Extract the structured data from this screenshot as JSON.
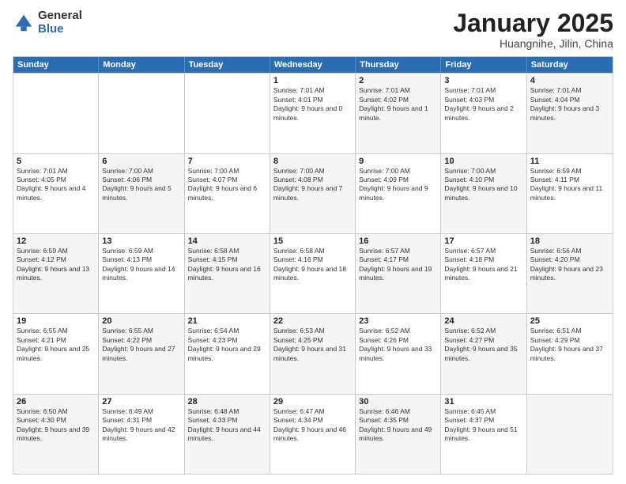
{
  "header": {
    "logo_general": "General",
    "logo_blue": "Blue",
    "title": "January 2025",
    "subtitle": "Huangnihe, Jilin, China"
  },
  "days_of_week": [
    "Sunday",
    "Monday",
    "Tuesday",
    "Wednesday",
    "Thursday",
    "Friday",
    "Saturday"
  ],
  "weeks": [
    [
      {
        "day": "",
        "sunrise": "",
        "sunset": "",
        "daylight": "",
        "shaded": false
      },
      {
        "day": "",
        "sunrise": "",
        "sunset": "",
        "daylight": "",
        "shaded": false
      },
      {
        "day": "",
        "sunrise": "",
        "sunset": "",
        "daylight": "",
        "shaded": false
      },
      {
        "day": "1",
        "sunrise": "Sunrise: 7:01 AM",
        "sunset": "Sunset: 4:01 PM",
        "daylight": "Daylight: 9 hours and 0 minutes.",
        "shaded": false
      },
      {
        "day": "2",
        "sunrise": "Sunrise: 7:01 AM",
        "sunset": "Sunset: 4:02 PM",
        "daylight": "Daylight: 9 hours and 1 minute.",
        "shaded": true
      },
      {
        "day": "3",
        "sunrise": "Sunrise: 7:01 AM",
        "sunset": "Sunset: 4:03 PM",
        "daylight": "Daylight: 9 hours and 2 minutes.",
        "shaded": false
      },
      {
        "day": "4",
        "sunrise": "Sunrise: 7:01 AM",
        "sunset": "Sunset: 4:04 PM",
        "daylight": "Daylight: 9 hours and 3 minutes.",
        "shaded": true
      }
    ],
    [
      {
        "day": "5",
        "sunrise": "Sunrise: 7:01 AM",
        "sunset": "Sunset: 4:05 PM",
        "daylight": "Daylight: 9 hours and 4 minutes.",
        "shaded": false
      },
      {
        "day": "6",
        "sunrise": "Sunrise: 7:00 AM",
        "sunset": "Sunset: 4:06 PM",
        "daylight": "Daylight: 9 hours and 5 minutes.",
        "shaded": true
      },
      {
        "day": "7",
        "sunrise": "Sunrise: 7:00 AM",
        "sunset": "Sunset: 4:07 PM",
        "daylight": "Daylight: 9 hours and 6 minutes.",
        "shaded": false
      },
      {
        "day": "8",
        "sunrise": "Sunrise: 7:00 AM",
        "sunset": "Sunset: 4:08 PM",
        "daylight": "Daylight: 9 hours and 7 minutes.",
        "shaded": true
      },
      {
        "day": "9",
        "sunrise": "Sunrise: 7:00 AM",
        "sunset": "Sunset: 4:09 PM",
        "daylight": "Daylight: 9 hours and 9 minutes.",
        "shaded": false
      },
      {
        "day": "10",
        "sunrise": "Sunrise: 7:00 AM",
        "sunset": "Sunset: 4:10 PM",
        "daylight": "Daylight: 9 hours and 10 minutes.",
        "shaded": true
      },
      {
        "day": "11",
        "sunrise": "Sunrise: 6:59 AM",
        "sunset": "Sunset: 4:11 PM",
        "daylight": "Daylight: 9 hours and 11 minutes.",
        "shaded": false
      }
    ],
    [
      {
        "day": "12",
        "sunrise": "Sunrise: 6:59 AM",
        "sunset": "Sunset: 4:12 PM",
        "daylight": "Daylight: 9 hours and 13 minutes.",
        "shaded": true
      },
      {
        "day": "13",
        "sunrise": "Sunrise: 6:59 AM",
        "sunset": "Sunset: 4:13 PM",
        "daylight": "Daylight: 9 hours and 14 minutes.",
        "shaded": false
      },
      {
        "day": "14",
        "sunrise": "Sunrise: 6:58 AM",
        "sunset": "Sunset: 4:15 PM",
        "daylight": "Daylight: 9 hours and 16 minutes.",
        "shaded": true
      },
      {
        "day": "15",
        "sunrise": "Sunrise: 6:58 AM",
        "sunset": "Sunset: 4:16 PM",
        "daylight": "Daylight: 9 hours and 18 minutes.",
        "shaded": false
      },
      {
        "day": "16",
        "sunrise": "Sunrise: 6:57 AM",
        "sunset": "Sunset: 4:17 PM",
        "daylight": "Daylight: 9 hours and 19 minutes.",
        "shaded": true
      },
      {
        "day": "17",
        "sunrise": "Sunrise: 6:57 AM",
        "sunset": "Sunset: 4:18 PM",
        "daylight": "Daylight: 9 hours and 21 minutes.",
        "shaded": false
      },
      {
        "day": "18",
        "sunrise": "Sunrise: 6:56 AM",
        "sunset": "Sunset: 4:20 PM",
        "daylight": "Daylight: 9 hours and 23 minutes.",
        "shaded": true
      }
    ],
    [
      {
        "day": "19",
        "sunrise": "Sunrise: 6:55 AM",
        "sunset": "Sunset: 4:21 PM",
        "daylight": "Daylight: 9 hours and 25 minutes.",
        "shaded": false
      },
      {
        "day": "20",
        "sunrise": "Sunrise: 6:55 AM",
        "sunset": "Sunset: 4:22 PM",
        "daylight": "Daylight: 9 hours and 27 minutes.",
        "shaded": true
      },
      {
        "day": "21",
        "sunrise": "Sunrise: 6:54 AM",
        "sunset": "Sunset: 4:23 PM",
        "daylight": "Daylight: 9 hours and 29 minutes.",
        "shaded": false
      },
      {
        "day": "22",
        "sunrise": "Sunrise: 6:53 AM",
        "sunset": "Sunset: 4:25 PM",
        "daylight": "Daylight: 9 hours and 31 minutes.",
        "shaded": true
      },
      {
        "day": "23",
        "sunrise": "Sunrise: 6:52 AM",
        "sunset": "Sunset: 4:26 PM",
        "daylight": "Daylight: 9 hours and 33 minutes.",
        "shaded": false
      },
      {
        "day": "24",
        "sunrise": "Sunrise: 6:52 AM",
        "sunset": "Sunset: 4:27 PM",
        "daylight": "Daylight: 9 hours and 35 minutes.",
        "shaded": true
      },
      {
        "day": "25",
        "sunrise": "Sunrise: 6:51 AM",
        "sunset": "Sunset: 4:29 PM",
        "daylight": "Daylight: 9 hours and 37 minutes.",
        "shaded": false
      }
    ],
    [
      {
        "day": "26",
        "sunrise": "Sunrise: 6:50 AM",
        "sunset": "Sunset: 4:30 PM",
        "daylight": "Daylight: 9 hours and 39 minutes.",
        "shaded": true
      },
      {
        "day": "27",
        "sunrise": "Sunrise: 6:49 AM",
        "sunset": "Sunset: 4:31 PM",
        "daylight": "Daylight: 9 hours and 42 minutes.",
        "shaded": false
      },
      {
        "day": "28",
        "sunrise": "Sunrise: 6:48 AM",
        "sunset": "Sunset: 4:33 PM",
        "daylight": "Daylight: 9 hours and 44 minutes.",
        "shaded": true
      },
      {
        "day": "29",
        "sunrise": "Sunrise: 6:47 AM",
        "sunset": "Sunset: 4:34 PM",
        "daylight": "Daylight: 9 hours and 46 minutes.",
        "shaded": false
      },
      {
        "day": "30",
        "sunrise": "Sunrise: 6:46 AM",
        "sunset": "Sunset: 4:35 PM",
        "daylight": "Daylight: 9 hours and 49 minutes.",
        "shaded": true
      },
      {
        "day": "31",
        "sunrise": "Sunrise: 6:45 AM",
        "sunset": "Sunset: 4:37 PM",
        "daylight": "Daylight: 9 hours and 51 minutes.",
        "shaded": false
      },
      {
        "day": "",
        "sunrise": "",
        "sunset": "",
        "daylight": "",
        "shaded": true
      }
    ]
  ]
}
